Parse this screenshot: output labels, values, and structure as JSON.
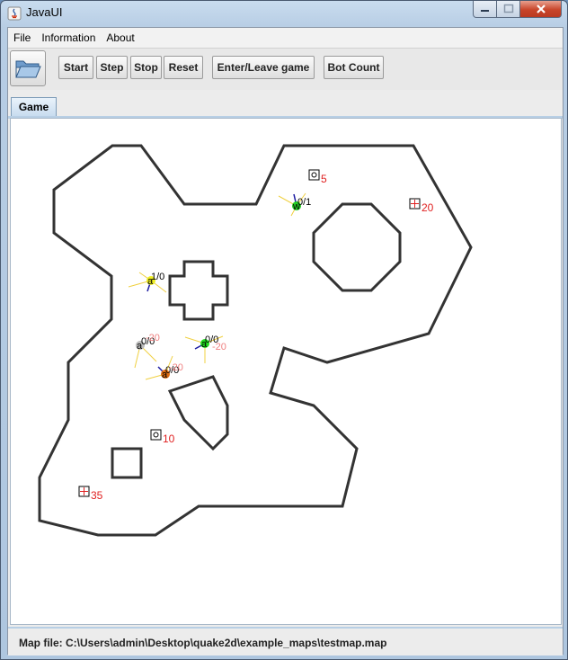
{
  "window": {
    "title": "JavaUI",
    "minimize_glyph": "–",
    "close_glyph": "X"
  },
  "menu": [
    "File",
    "Information",
    "About"
  ],
  "toolbar": {
    "open_icon": "folder-open-icon",
    "buttons": [
      "Start",
      "Step",
      "Stop",
      "Reset",
      "Enter/Leave game",
      "Bot Count"
    ]
  },
  "tabs": [
    "Game"
  ],
  "map": {
    "items": [
      {
        "kind": "ammo",
        "value": "5"
      },
      {
        "kind": "health",
        "value": "20"
      },
      {
        "kind": "ammo",
        "value": "10"
      },
      {
        "kind": "health",
        "value": "35"
      }
    ],
    "bots": [
      {
        "label": "w",
        "score": "0/1",
        "color": "#22cc22",
        "extra": ""
      },
      {
        "label": "a",
        "score": "1/0",
        "color": "#eeee22",
        "extra": ""
      },
      {
        "label": "a",
        "score": "0/0",
        "color": "#bbbbbb",
        "extra": "-20"
      },
      {
        "label": "a",
        "score": "0/0",
        "color": "#22dd22",
        "extra": "-20"
      },
      {
        "label": "a",
        "score": "0/0",
        "color": "#dd6a10",
        "extra": "-20"
      }
    ]
  },
  "status": {
    "text": "Map file: C:\\Users\\admin\\Desktop\\quake2d\\example_maps\\testmap.map"
  },
  "colors": {
    "wall": "#333333",
    "item_label": "#e02020",
    "bot_extra": "#f08080"
  }
}
